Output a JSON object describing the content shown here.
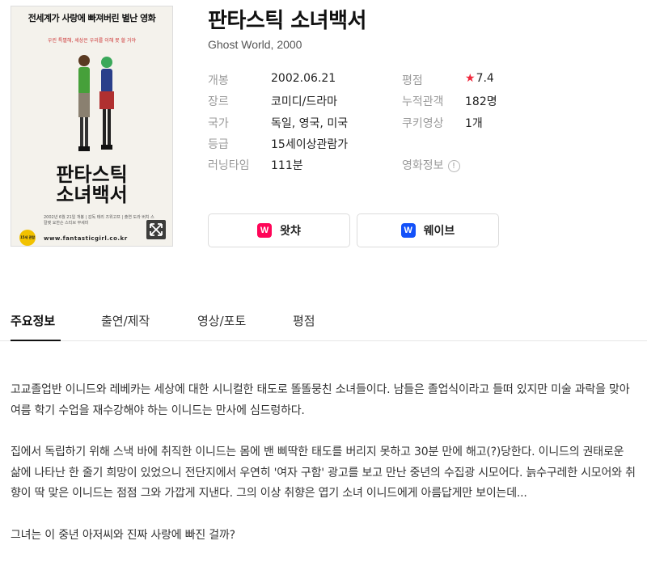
{
  "poster": {
    "top_text": "전세계가 사랑에 빠져버린 별난 영화",
    "tagline": "우린 특별해, 세상은 우리를 이해 못 할 거야",
    "title_line1": "판타스틱",
    "title_line2": "소녀백서",
    "credits": "2002년 6월 21일 개봉 | 감독 테리 즈위고프 | 출연 도라 버치 스칼렛 요한슨 스티브 부세미",
    "url": "www.fantasticgirl.co.kr",
    "rating_badge": "15세 관람가"
  },
  "movie": {
    "title": "판타스틱 소녀백서",
    "subtitle": "Ghost World, 2000"
  },
  "info": {
    "release_label": "개봉",
    "release_value": "2002.06.21",
    "genre_label": "장르",
    "genre_value": "코미디/드라마",
    "country_label": "국가",
    "country_value": "독일, 영국, 미국",
    "grade_label": "등급",
    "grade_value": "15세이상관람가",
    "runtime_label": "러닝타임",
    "runtime_value": "111분",
    "rating_label": "평점",
    "rating_star": "★",
    "rating_value": "7.4",
    "audience_label": "누적관객",
    "audience_value": "182명",
    "cookie_label": "쿠키영상",
    "cookie_value": "1개",
    "movieinfo_label": "영화정보",
    "movieinfo_icon": "!"
  },
  "ott": {
    "watcha_label": "왓챠",
    "watcha_logo": "W",
    "watcha_color": "#ff0558",
    "wavve_label": "웨이브",
    "wavve_logo": "W",
    "wavve_color": "#1351f9"
  },
  "tabs": {
    "main_info": "주요정보",
    "cast": "출연/제작",
    "media": "영상/포토",
    "review": "평점"
  },
  "synopsis": {
    "p1": "고교졸업반 이니드와 레베카는 세상에 대한 시니컬한 태도로 똘똘뭉친 소녀들이다. 남들은 졸업식이라고 들떠 있지만 미술 과락을 맞아 여름 학기 수업을 재수강해야 하는 이니드는 만사에 심드렁하다.",
    "p2": "집에서 독립하기 위해 스낵 바에 취직한 이니드는 몸에 밴 삐딱한 태도를 버리지 못하고 30분 만에 해고(?)당한다. 이니드의 권태로운 삶에 나타난 한 줄기 희망이 있었으니 전단지에서 우연히 '여자 구함' 광고를 보고 만난 중년의 수집광 시모어다. 늙수구레한 시모어와 취향이 딱 맞은 이니드는 점점 그와 가깝게 지낸다. 그의 이상 취향은 엽기 소녀 이니드에게 아름답게만 보이는데...",
    "p3": "그녀는 이 중년 아저씨와 진짜 사랑에 빠진 걸까?"
  }
}
